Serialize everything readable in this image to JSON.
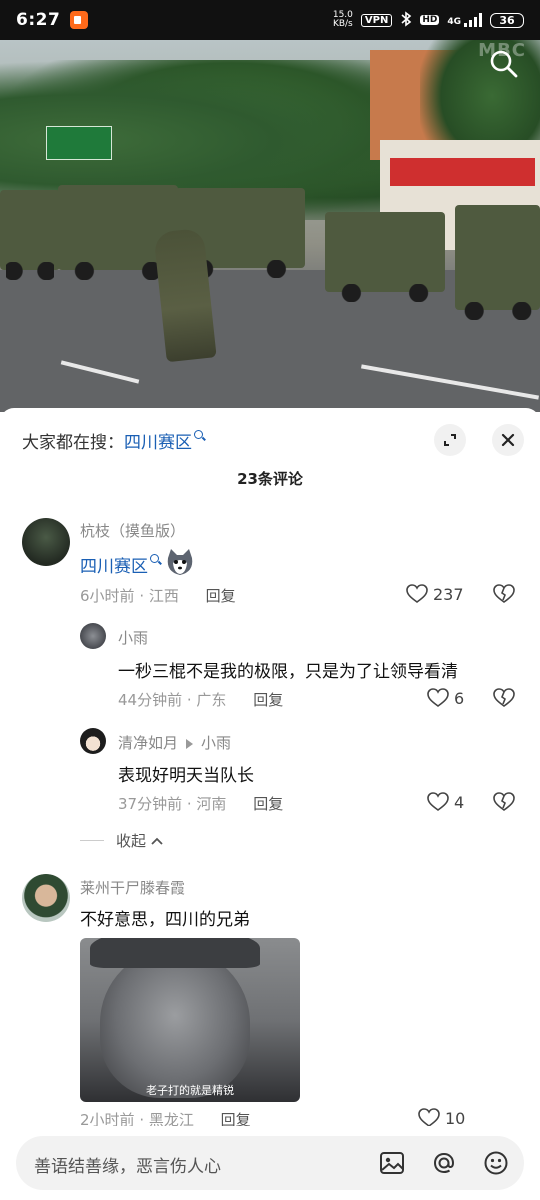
{
  "status_bar": {
    "time": "6:27",
    "speed": "15.0",
    "speed_unit": "KB/s",
    "vpn": "VPN",
    "hd": "HD",
    "network": "4G",
    "battery": "36"
  },
  "video": {
    "watermark": "MBC",
    "search_icon": "search-icon"
  },
  "sheet": {
    "hot_search_prefix": "大家都在搜：",
    "hot_search_term": "四川赛区",
    "comment_count": "23条评论",
    "expand_icon": "expand-icon",
    "close_icon": "close-icon"
  },
  "comments": [
    {
      "user": "杭枝（摸鱼版）",
      "text_link": "四川赛区",
      "emoji": "husky-emoji",
      "time": "6小时前",
      "location": "江西",
      "reply_label": "回复",
      "likes": "237"
    },
    {
      "user": "小雨",
      "text": "一秒三棍不是我的极限，只是为了让领导看清",
      "time": "44分钟前",
      "location": "广东",
      "reply_label": "回复",
      "likes": "6"
    },
    {
      "user": "清净如月",
      "reply_to": "小雨",
      "text": "表现好明天当队长",
      "time": "37分钟前",
      "location": "河南",
      "reply_label": "回复",
      "likes": "4"
    },
    {
      "user": "莱州干尸滕春霞",
      "text": "不好意思，四川的兄弟",
      "image_caption": "老子打的就是精锐",
      "time": "2小时前",
      "location": "黑龙江",
      "reply_label": "回复",
      "likes": "10"
    }
  ],
  "collapse_label": "收起",
  "input": {
    "placeholder": "善语结善缘，恶言伤人心",
    "icons": [
      "image-icon",
      "at-icon",
      "emoji-icon"
    ]
  },
  "colors": {
    "link": "#1a5fb4",
    "accent_app": "#ff6a1a"
  }
}
